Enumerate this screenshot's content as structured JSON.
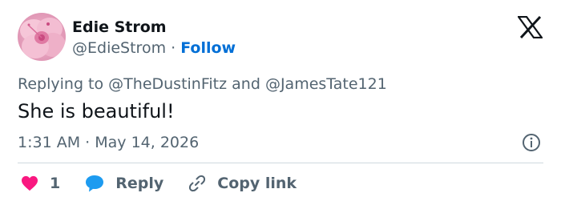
{
  "author": {
    "name": "Edie Strom",
    "handle": "@EdieStrom",
    "separator": "·",
    "follow_label": "Follow",
    "avatar": "pink-hibiscus-flower"
  },
  "tweet": {
    "reply_prefix": "Replying to",
    "reply_users": [
      "@TheDustinFitz",
      "@JamesTate121"
    ],
    "reply_joiner": "and",
    "text": "She is beautiful!",
    "time": "1:31 AM",
    "date_separator": "·",
    "date": "May 14, 2026"
  },
  "actions": {
    "like_count": "1",
    "reply_label": "Reply",
    "copy_label": "Copy link"
  },
  "icons": {
    "brand": "x-logo-icon",
    "info": "info-icon",
    "like": "heart-icon",
    "reply": "chat-bubble-icon",
    "copy": "link-icon"
  },
  "colors": {
    "text": "#0f1419",
    "secondary": "#536471",
    "follow": "#006fd6",
    "heart": "#f91880",
    "reply_bubble": "#1d9bf0",
    "divider": "#cfd9de"
  }
}
